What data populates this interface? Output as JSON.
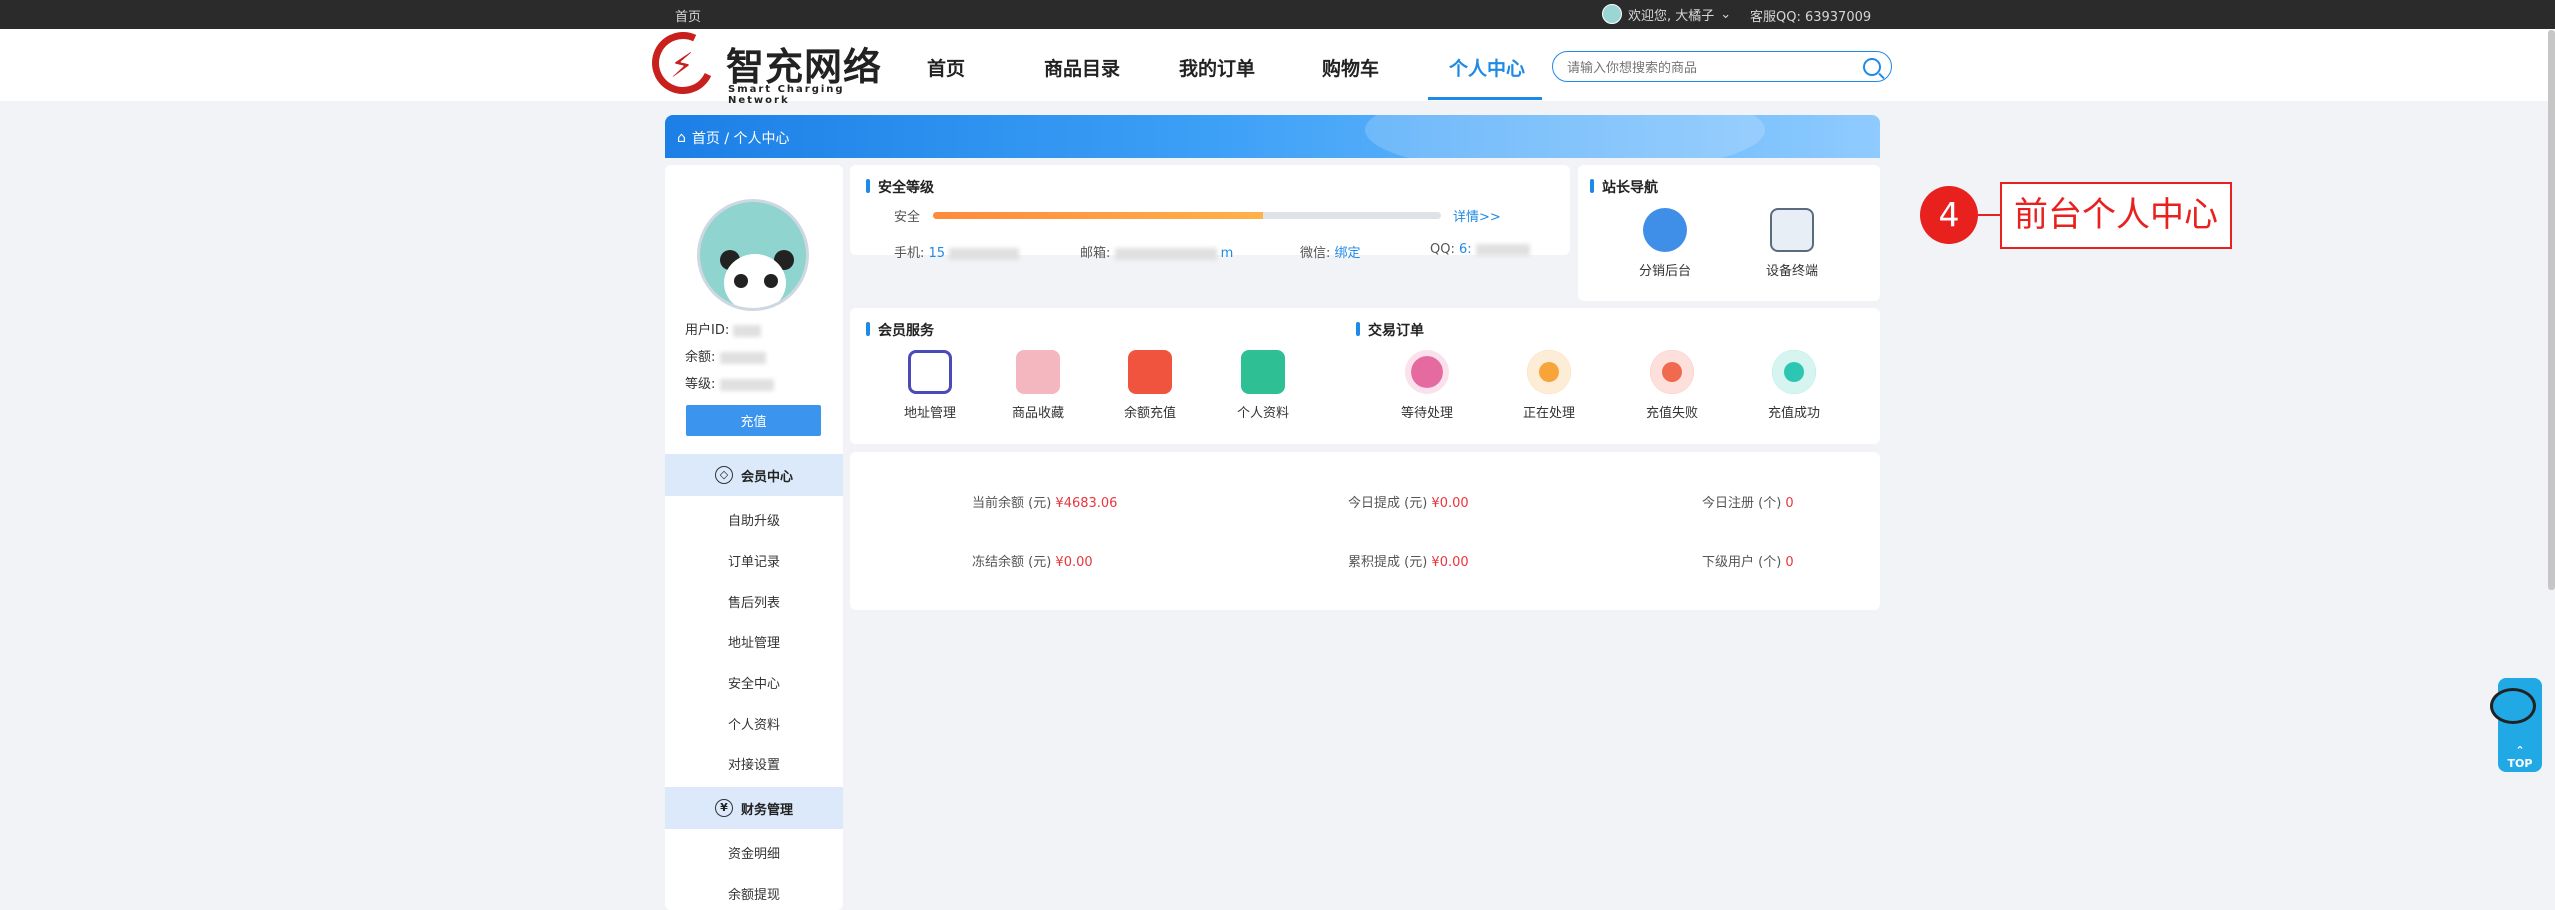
{
  "topbar": {
    "home": "首页",
    "welcome": "欢迎您, 大橘子",
    "qq_label": "客服QQ: 63937009"
  },
  "logo": {
    "cn": "智充网络",
    "en": "Smart Charging Network"
  },
  "nav": [
    {
      "label": "首页"
    },
    {
      "label": "商品目录"
    },
    {
      "label": "我的订单"
    },
    {
      "label": "购物车"
    },
    {
      "label": "个人中心",
      "active": true
    }
  ],
  "search": {
    "placeholder": "请输入你想搜索的商品"
  },
  "breadcrumb": "首页 / 个人中心",
  "user": {
    "id_label": "用户ID:",
    "balance_label": "余额:",
    "level_label": "等级:",
    "recharge": "充值"
  },
  "sidebar": {
    "group1": "会员中心",
    "items1": [
      "自助升级",
      "订单记录",
      "售后列表",
      "地址管理",
      "安全中心",
      "个人资料",
      "对接设置"
    ],
    "group2": "财务管理",
    "items2": [
      "资金明细",
      "余额提现"
    ]
  },
  "security": {
    "title": "安全等级",
    "label": "安全",
    "progress": 0.65,
    "details": "详情>>",
    "phone_label": "手机:",
    "phone_value": "15",
    "email_label": "邮箱:",
    "email_value": "m",
    "wechat_label": "微信:",
    "wechat_value": "绑定",
    "qq_label": "QQ:",
    "qq_value": "6:"
  },
  "station": {
    "title": "站长导航",
    "items": [
      "分销后台",
      "设备终端"
    ]
  },
  "member_service": {
    "title": "会员服务",
    "items": [
      "地址管理",
      "商品收藏",
      "余额充值",
      "个人资料"
    ]
  },
  "trade_orders": {
    "title": "交易订单",
    "items": [
      "等待处理",
      "正在处理",
      "充值失败",
      "充值成功"
    ]
  },
  "stats": [
    {
      "label": "当前余额 (元)",
      "value": "¥4683.06"
    },
    {
      "label": "今日提成 (元)",
      "value": "¥0.00"
    },
    {
      "label": "今日注册 (个)",
      "value": "0"
    },
    {
      "label": "冻结余额 (元)",
      "value": "¥0.00"
    },
    {
      "label": "累积提成 (元)",
      "value": "¥0.00"
    },
    {
      "label": "下级用户 (个)",
      "value": "0"
    }
  ],
  "callout": {
    "number": "4",
    "text": "前台个人中心"
  },
  "float": {
    "top": "TOP"
  },
  "colors": {
    "accent": "#1e8ae8",
    "callout": "#e8211f",
    "progress": "#ff8a3c"
  }
}
